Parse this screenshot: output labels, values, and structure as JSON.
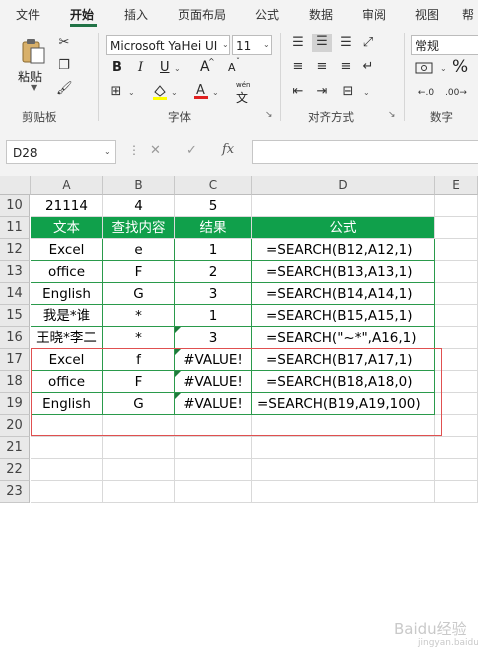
{
  "menu": [
    "文件",
    "开始",
    "插入",
    "页面布局",
    "公式",
    "数据",
    "审阅",
    "视图",
    "帮"
  ],
  "ribbon": {
    "paste_label": "粘贴",
    "clipboard_group": "剪贴板",
    "font_name": "Microsoft YaHei UI",
    "font_size": "11",
    "font_group": "字体",
    "align_group": "对齐方式",
    "number_format": "常规",
    "number_group": "数字",
    "bold": "B",
    "italic": "I",
    "underline": "U",
    "grow_font": "A",
    "shrink_font": "A",
    "wen": "wén",
    "wen_char": "文",
    "percent": "%"
  },
  "formula_bar": {
    "name_box": "D28",
    "fx": "fx",
    "cancel": "✕",
    "enter": "✓"
  },
  "columns": [
    "A",
    "B",
    "C",
    "D",
    "E"
  ],
  "rows": [
    {
      "num": "10",
      "cells": [
        "21114",
        "4",
        "5",
        ""
      ]
    },
    {
      "num": "11",
      "cells": [
        "文本",
        "查找内容",
        "结果",
        "公式"
      ]
    },
    {
      "num": "12",
      "cells": [
        "Excel",
        "e",
        "1",
        "=SEARCH(B12,A12,1)"
      ]
    },
    {
      "num": "13",
      "cells": [
        "office",
        "F",
        "2",
        "=SEARCH(B13,A13,1)"
      ]
    },
    {
      "num": "14",
      "cells": [
        "English",
        "G",
        "3",
        "=SEARCH(B14,A14,1)"
      ]
    },
    {
      "num": "15",
      "cells": [
        "我是*谁",
        "*",
        "1",
        "=SEARCH(B15,A15,1)"
      ]
    },
    {
      "num": "16",
      "cells": [
        "王晓*李二",
        "*",
        "3",
        "=SEARCH(\"~*\",A16,1)"
      ]
    },
    {
      "num": "17",
      "cells": [
        "Excel",
        "f",
        "#VALUE!",
        "=SEARCH(B17,A17,1)"
      ]
    },
    {
      "num": "18",
      "cells": [
        "office",
        "F",
        "#VALUE!",
        "=SEARCH(B18,A18,0)"
      ]
    },
    {
      "num": "19",
      "cells": [
        "English",
        "G",
        "#VALUE!",
        "=SEARCH(B19,A19,100)"
      ]
    },
    {
      "num": "20",
      "cells": [
        "",
        "",
        "",
        ""
      ]
    },
    {
      "num": "21",
      "cells": [
        "",
        "",
        "",
        ""
      ]
    },
    {
      "num": "22",
      "cells": [
        "",
        "",
        "",
        ""
      ]
    },
    {
      "num": "23",
      "cells": [
        "",
        "",
        "",
        ""
      ]
    }
  ],
  "watermark": "Baidu经验",
  "watermark_sub": "jingyan.baidu.com",
  "colors": {
    "header_fill": "#10a04b",
    "accent": "#217346",
    "highlight_box": "#e05050"
  }
}
